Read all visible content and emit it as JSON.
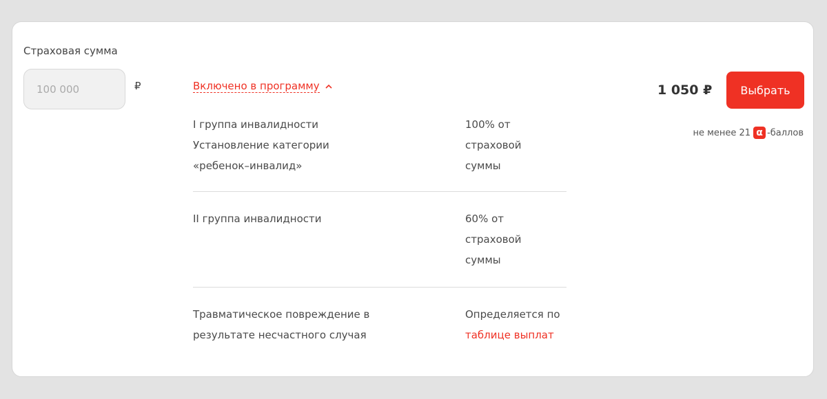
{
  "form": {
    "sum_label": "Страховая сумма",
    "sum_placeholder": "100 000",
    "currency": "₽"
  },
  "program": {
    "toggle_label": "Включено в программу",
    "toggle_icon": "chevron-up-icon",
    "rows": [
      {
        "name_lines": [
          "I группа инвалидности",
          "Установление категории",
          "«ребенок–инвалид»"
        ],
        "value_lines": [
          "100% от",
          "страховой",
          "суммы"
        ]
      },
      {
        "name_lines": [
          "II группа инвалидности"
        ],
        "value_lines": [
          "60% от",
          "страховой",
          "суммы"
        ]
      },
      {
        "name_lines": [
          "Травматическое повреждение в",
          "результате несчастного случая"
        ],
        "value_lines": [
          "Определяется по"
        ],
        "value_link": "таблице выплат"
      }
    ]
  },
  "offer": {
    "price": "1 050 ₽",
    "button_label": "Выбрать",
    "points_prefix": "не менее 21",
    "points_icon": "alpha-icon",
    "points_icon_glyph": "α",
    "points_suffix": "-баллов"
  },
  "colors": {
    "accent": "#ef3124",
    "background": "#e3e3e3",
    "card": "#ffffff"
  }
}
